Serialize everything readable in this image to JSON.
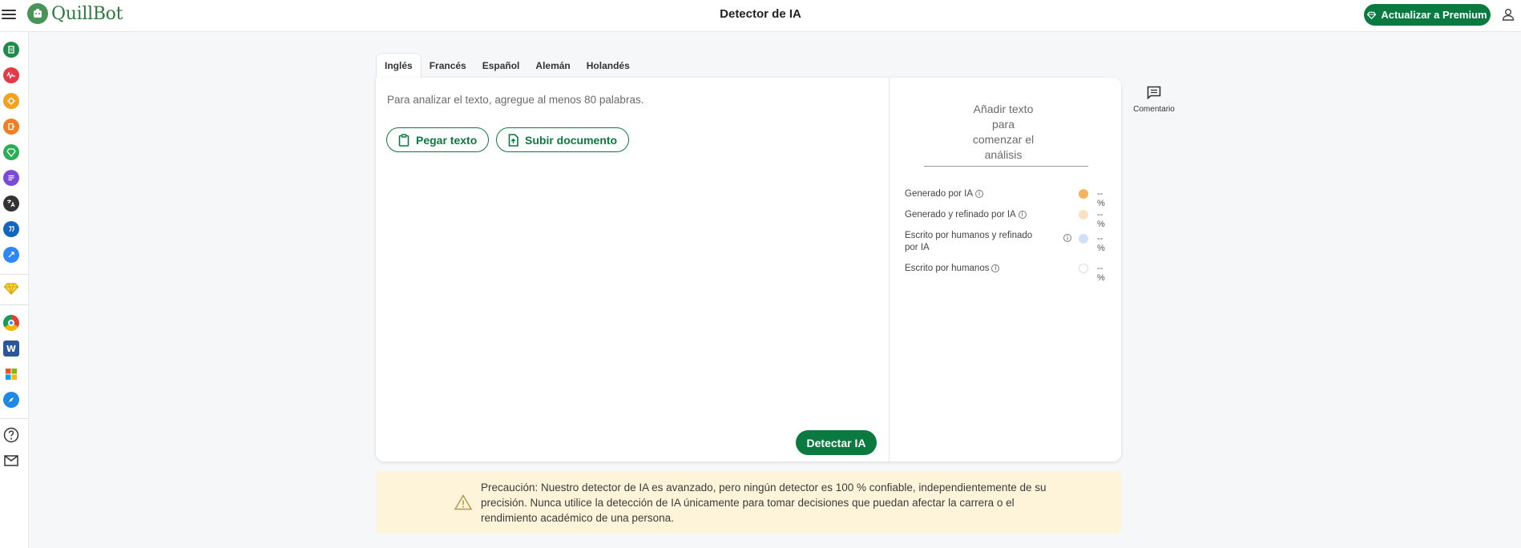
{
  "app": {
    "name": "QuillBot",
    "page_title": "Detector de IA"
  },
  "header": {
    "premium_label": "Actualizar a Premium",
    "premium_color": "#0b7a40"
  },
  "sidebar": {
    "items": [
      {
        "name": "paraphraser",
        "color": "#1e8a4b"
      },
      {
        "name": "grammar-checker",
        "color": "#e53947"
      },
      {
        "name": "ai-detector",
        "color": "#f4a11f"
      },
      {
        "name": "plagiarism-checker",
        "color": "#ee7f24"
      },
      {
        "name": "ai-humanizer",
        "color": "#2cae57"
      },
      {
        "name": "summarizer",
        "color": "#7b4bd8"
      },
      {
        "name": "translator",
        "color": "#333333"
      },
      {
        "name": "citation-generator",
        "color": "#1565c0"
      },
      {
        "name": "quillbot-flow",
        "color": "#2f86f6"
      },
      {
        "name": "premium",
        "color": "#f2b705"
      },
      {
        "name": "chrome-extension",
        "color": "#db4437"
      },
      {
        "name": "word-addin",
        "color": "#2b579a"
      },
      {
        "name": "microsoft-store",
        "color": "#f25022"
      },
      {
        "name": "safari-extension",
        "color": "#1e88e5"
      },
      {
        "name": "help",
        "color": "#333333"
      },
      {
        "name": "contact",
        "color": "#333333"
      }
    ]
  },
  "tabs": [
    {
      "label": "Inglés",
      "active": true
    },
    {
      "label": "Francés",
      "active": false
    },
    {
      "label": "Español",
      "active": false
    },
    {
      "label": "Alemán",
      "active": false
    },
    {
      "label": "Holandés",
      "active": false
    }
  ],
  "editor": {
    "placeholder": "Para analizar el texto, agregue al menos 80 palabras.",
    "paste_label": "Pegar texto",
    "upload_label": "Subir documento",
    "detect_label": "Detectar IA"
  },
  "results": {
    "empty_lines": [
      "Añadir texto",
      "para",
      "comenzar el",
      "análisis"
    ],
    "legend": [
      {
        "label": "Generado por IA",
        "value": "-- %",
        "color": "#f4b35c"
      },
      {
        "label": "Generado y refinado por IA",
        "value": "-- %",
        "color": "#f8e2c2"
      },
      {
        "label": "Escrito por humanos y refinado por IA",
        "value": "-- %",
        "color": "#d0e0fb"
      },
      {
        "label": "Escrito por humanos",
        "value": "-- %",
        "color": "#ffffff"
      }
    ]
  },
  "comment": {
    "label": "Comentario"
  },
  "caution": {
    "lines": [
      "Precaución: Nuestro detector de IA es avanzado, pero ningún detector es 100 % confiable, independientemente de su",
      "precisión. Nunca utilice la detección de IA únicamente para tomar decisiones que puedan afectar la carrera o el",
      "rendimiento académico de una persona."
    ],
    "background": "#fdf4d9"
  }
}
